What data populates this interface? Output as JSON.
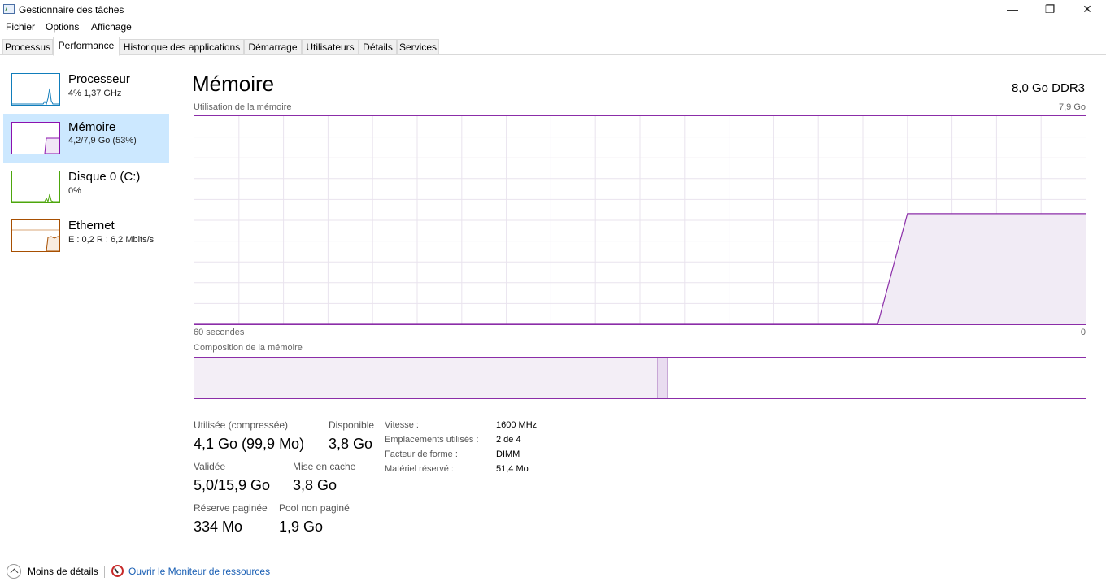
{
  "window": {
    "title": "Gestionnaire des tâches",
    "minimize_glyph": "—",
    "maximize_glyph": "❐",
    "close_glyph": "✕"
  },
  "menu": [
    "Fichier",
    "Options",
    "Affichage"
  ],
  "tabs": [
    "Processus",
    "Performance",
    "Historique des applications",
    "Démarrage",
    "Utilisateurs",
    "Détails",
    "Services"
  ],
  "active_tab": "Performance",
  "sidebar": {
    "items": [
      {
        "title": "Processeur",
        "subtitle": "4% 1,37 GHz",
        "color": "#117dbb",
        "icon": "cpu-graph-icon"
      },
      {
        "title": "Mémoire",
        "subtitle": "4,2/7,9 Go (53%)",
        "color": "#8b12ae",
        "icon": "memory-graph-icon"
      },
      {
        "title": "Disque 0 (C:)",
        "subtitle": "0%",
        "color": "#4da60c",
        "icon": "disk-graph-icon"
      },
      {
        "title": "Ethernet",
        "subtitle": "E : 0,2 R : 6,2 Mbits/s",
        "color": "#a74f01",
        "icon": "ethernet-graph-icon"
      }
    ],
    "selected": "Mémoire"
  },
  "main": {
    "title": "Mémoire",
    "type": "8,0 Go DDR3",
    "usage_label": "Utilisation de la mémoire",
    "usage_max": "7,9 Go",
    "time_left": "60 secondes",
    "time_right": "0",
    "composition_label": "Composition de la mémoire",
    "accent": "#8b2da8"
  },
  "chart_data": {
    "type": "area",
    "title": "Utilisation de la mémoire",
    "x_unit": "seconds ago",
    "x": [
      60,
      14,
      12,
      10,
      8,
      4,
      0
    ],
    "y": [
      0,
      0,
      4.2,
      4.2,
      4.2,
      4.2,
      4.2
    ],
    "ylim": [
      0,
      7.9
    ],
    "xlabel": "60 secondes",
    "grid": true
  },
  "composition": {
    "in_use_fraction": 0.52,
    "modified_fraction": 0.011
  },
  "stats": {
    "used_label": "Utilisée (compressée)",
    "used_value": "4,1 Go (99,9 Mo)",
    "available_label": "Disponible",
    "available_value": "3,8 Go",
    "committed_label": "Validée",
    "committed_value": "5,0/15,9 Go",
    "cached_label": "Mise en cache",
    "cached_value": "3,8 Go",
    "paged_label": "Réserve paginée",
    "paged_value": "334 Mo",
    "nonpaged_label": "Pool non paginé",
    "nonpaged_value": "1,9 Go"
  },
  "info": [
    {
      "label": "Vitesse :",
      "value": "1600 MHz"
    },
    {
      "label": "Emplacements utilisés :",
      "value": "2 de 4"
    },
    {
      "label": "Facteur de forme :",
      "value": "DIMM"
    },
    {
      "label": "Matériel réservé :",
      "value": "51,4 Mo"
    }
  ],
  "footer": {
    "less_details": "Moins de détails",
    "resource_monitor": "Ouvrir le Moniteur de ressources"
  }
}
